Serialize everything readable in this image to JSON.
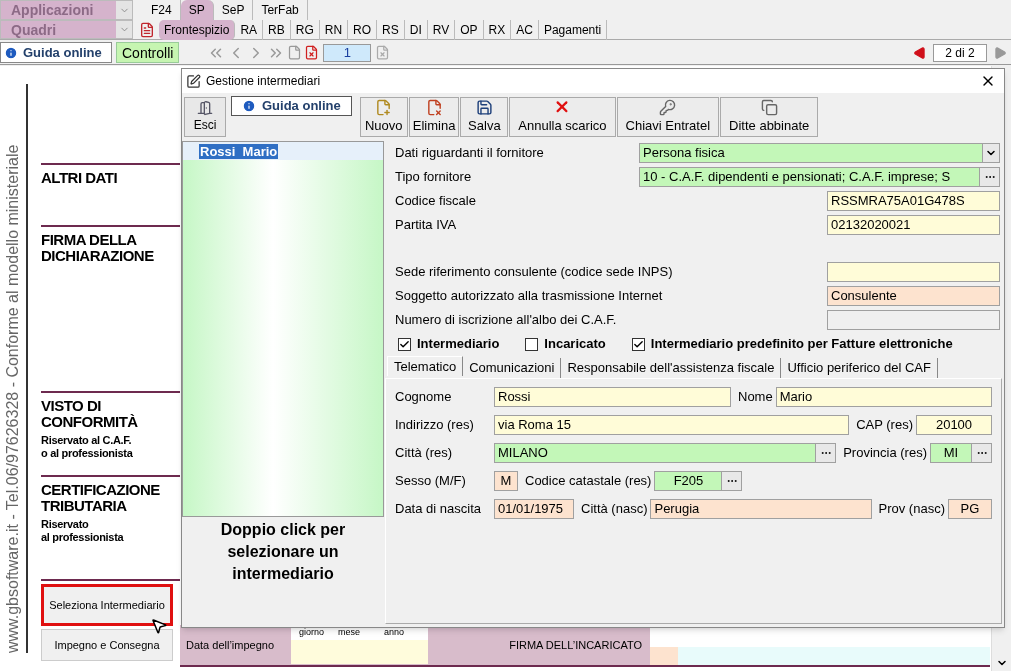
{
  "app_menu": {
    "applicazioni": "Applicazioni",
    "quadri": "Quadri"
  },
  "tabs_top": [
    {
      "label": "F24",
      "selected": false
    },
    {
      "label": "SP",
      "selected": true
    },
    {
      "label": "SeP",
      "selected": false
    },
    {
      "label": "TerFab",
      "selected": false
    }
  ],
  "tabs_quadri": [
    {
      "label": "Frontespizio",
      "selected": true
    },
    {
      "label": "RA",
      "selected": false
    },
    {
      "label": "RB",
      "selected": false
    },
    {
      "label": "RG",
      "selected": false
    },
    {
      "label": "RN",
      "selected": false
    },
    {
      "label": "RO",
      "selected": false
    },
    {
      "label": "RS",
      "selected": false
    },
    {
      "label": "DI",
      "selected": false
    },
    {
      "label": "RV",
      "selected": false
    },
    {
      "label": "OP",
      "selected": false
    },
    {
      "label": "RX",
      "selected": false
    },
    {
      "label": "AC",
      "selected": false
    },
    {
      "label": "Pagamenti",
      "selected": false
    }
  ],
  "toolbar": {
    "guida": "Guida online",
    "controlli": "Controlli",
    "page": "1",
    "page_count": "2 di 2"
  },
  "side_text": "www.gbsoftware.it - Tel.06/97626328 - Conforme al modello ministeriale",
  "sections": [
    {
      "title": "ALTRI DATI"
    },
    {
      "title": "FIRMA DELLA DICHIARAZIONE"
    },
    {
      "title": "VISTO DI CONFORMITÀ",
      "subtitle": "Riservato al C.A.F.\no al professionista"
    },
    {
      "title": "CERTIFICAZIONE TRIBUTARIA",
      "subtitle": "Riservato\nal professionista"
    }
  ],
  "side_buttons": [
    {
      "label": "Seleziona Intermediario",
      "highlighted": true
    },
    {
      "label": "Impegno e Consegna",
      "highlighted": false
    }
  ],
  "impegno": {
    "label": "Data dell’impegno",
    "date_parts": [
      "giorno",
      "mese",
      "anno"
    ],
    "firma": "FIRMA DELL’INCARICATO"
  },
  "dialog": {
    "title": "Gestione intermediari",
    "exit": "Esci",
    "guida": "Guida online",
    "actions": [
      {
        "label": "Nuovo",
        "kind": "new"
      },
      {
        "label": "Elimina",
        "kind": "delete"
      },
      {
        "label": "Salva",
        "kind": "save"
      },
      {
        "label": "Annulla scarico",
        "kind": "cancel"
      },
      {
        "label": "Chiavi Entratel",
        "kind": "keys"
      },
      {
        "label": "Ditte abbinate",
        "kind": "linked"
      }
    ],
    "list": [
      {
        "name": "Rossi  Mario",
        "selected": true
      }
    ],
    "list_hint": "Doppio click per selezionare un intermediario",
    "fields": [
      {
        "label": "Dati riguardanti il fornitore",
        "value": "Persona fisica",
        "kind": "select"
      },
      {
        "label": "Tipo fornitore",
        "value": "10 - C.A.F. dipendenti e pensionati; C.A.F. imprese; S",
        "kind": "lookup"
      },
      {
        "label": "Codice fiscale",
        "value": "RSSMRA75A01G478S",
        "kind": "text"
      },
      {
        "label": "Partita IVA",
        "value": "02132020021",
        "kind": "text"
      },
      {
        "label": "Sede riferimento consulente (codice sede INPS)",
        "kind": "text"
      },
      {
        "label": "Soggetto autorizzato alla trasmissione Internet",
        "value": "Consulente",
        "kind": "auto"
      },
      {
        "label": "Numero di iscrizione all'albo dei C.A.F.",
        "kind": "readonly"
      }
    ],
    "checkboxes": [
      {
        "label": "Intermediario",
        "checked": true
      },
      {
        "label": "Incaricato",
        "checked": false
      },
      {
        "label": "Intermediario predefinito per Fatture elettroniche",
        "checked": true
      }
    ],
    "tabs": [
      {
        "label": "Telematico",
        "selected": true
      },
      {
        "label": "Comunicazioni",
        "selected": false
      },
      {
        "label": "Responsabile dell'assistenza fiscale",
        "selected": false
      },
      {
        "label": "Ufficio periferico del CAF",
        "selected": false
      }
    ],
    "tab_rows": [
      [
        {
          "label": "Cognome",
          "value": "Rossi",
          "kind": "text"
        },
        {
          "label": "Nome",
          "value": "Mario",
          "kind": "text"
        }
      ],
      [
        {
          "label": "Indirizzo (res)",
          "value": "via Roma 15",
          "kind": "text"
        },
        {
          "label": "CAP (res)",
          "value": "20100",
          "kind": "text"
        }
      ],
      [
        {
          "label": "Città (res)",
          "value": "MILANO",
          "kind": "lookup"
        },
        {
          "label": "Provincia (res)",
          "value": "MI",
          "kind": "lookup"
        }
      ],
      [
        {
          "label": "Sesso (M/F)",
          "value": "M",
          "kind": "auto"
        },
        {
          "label": "Codice catastale (res)",
          "value": "F205",
          "kind": "lookup"
        }
      ],
      [
        {
          "label": "Data di nascita",
          "value": "01/01/1975",
          "kind": "auto"
        },
        {
          "label": "Città (nasc)",
          "value": "Perugia",
          "kind": "auto"
        },
        {
          "label": "Prov (nasc)",
          "value": "PG",
          "kind": "auto"
        }
      ]
    ]
  }
}
